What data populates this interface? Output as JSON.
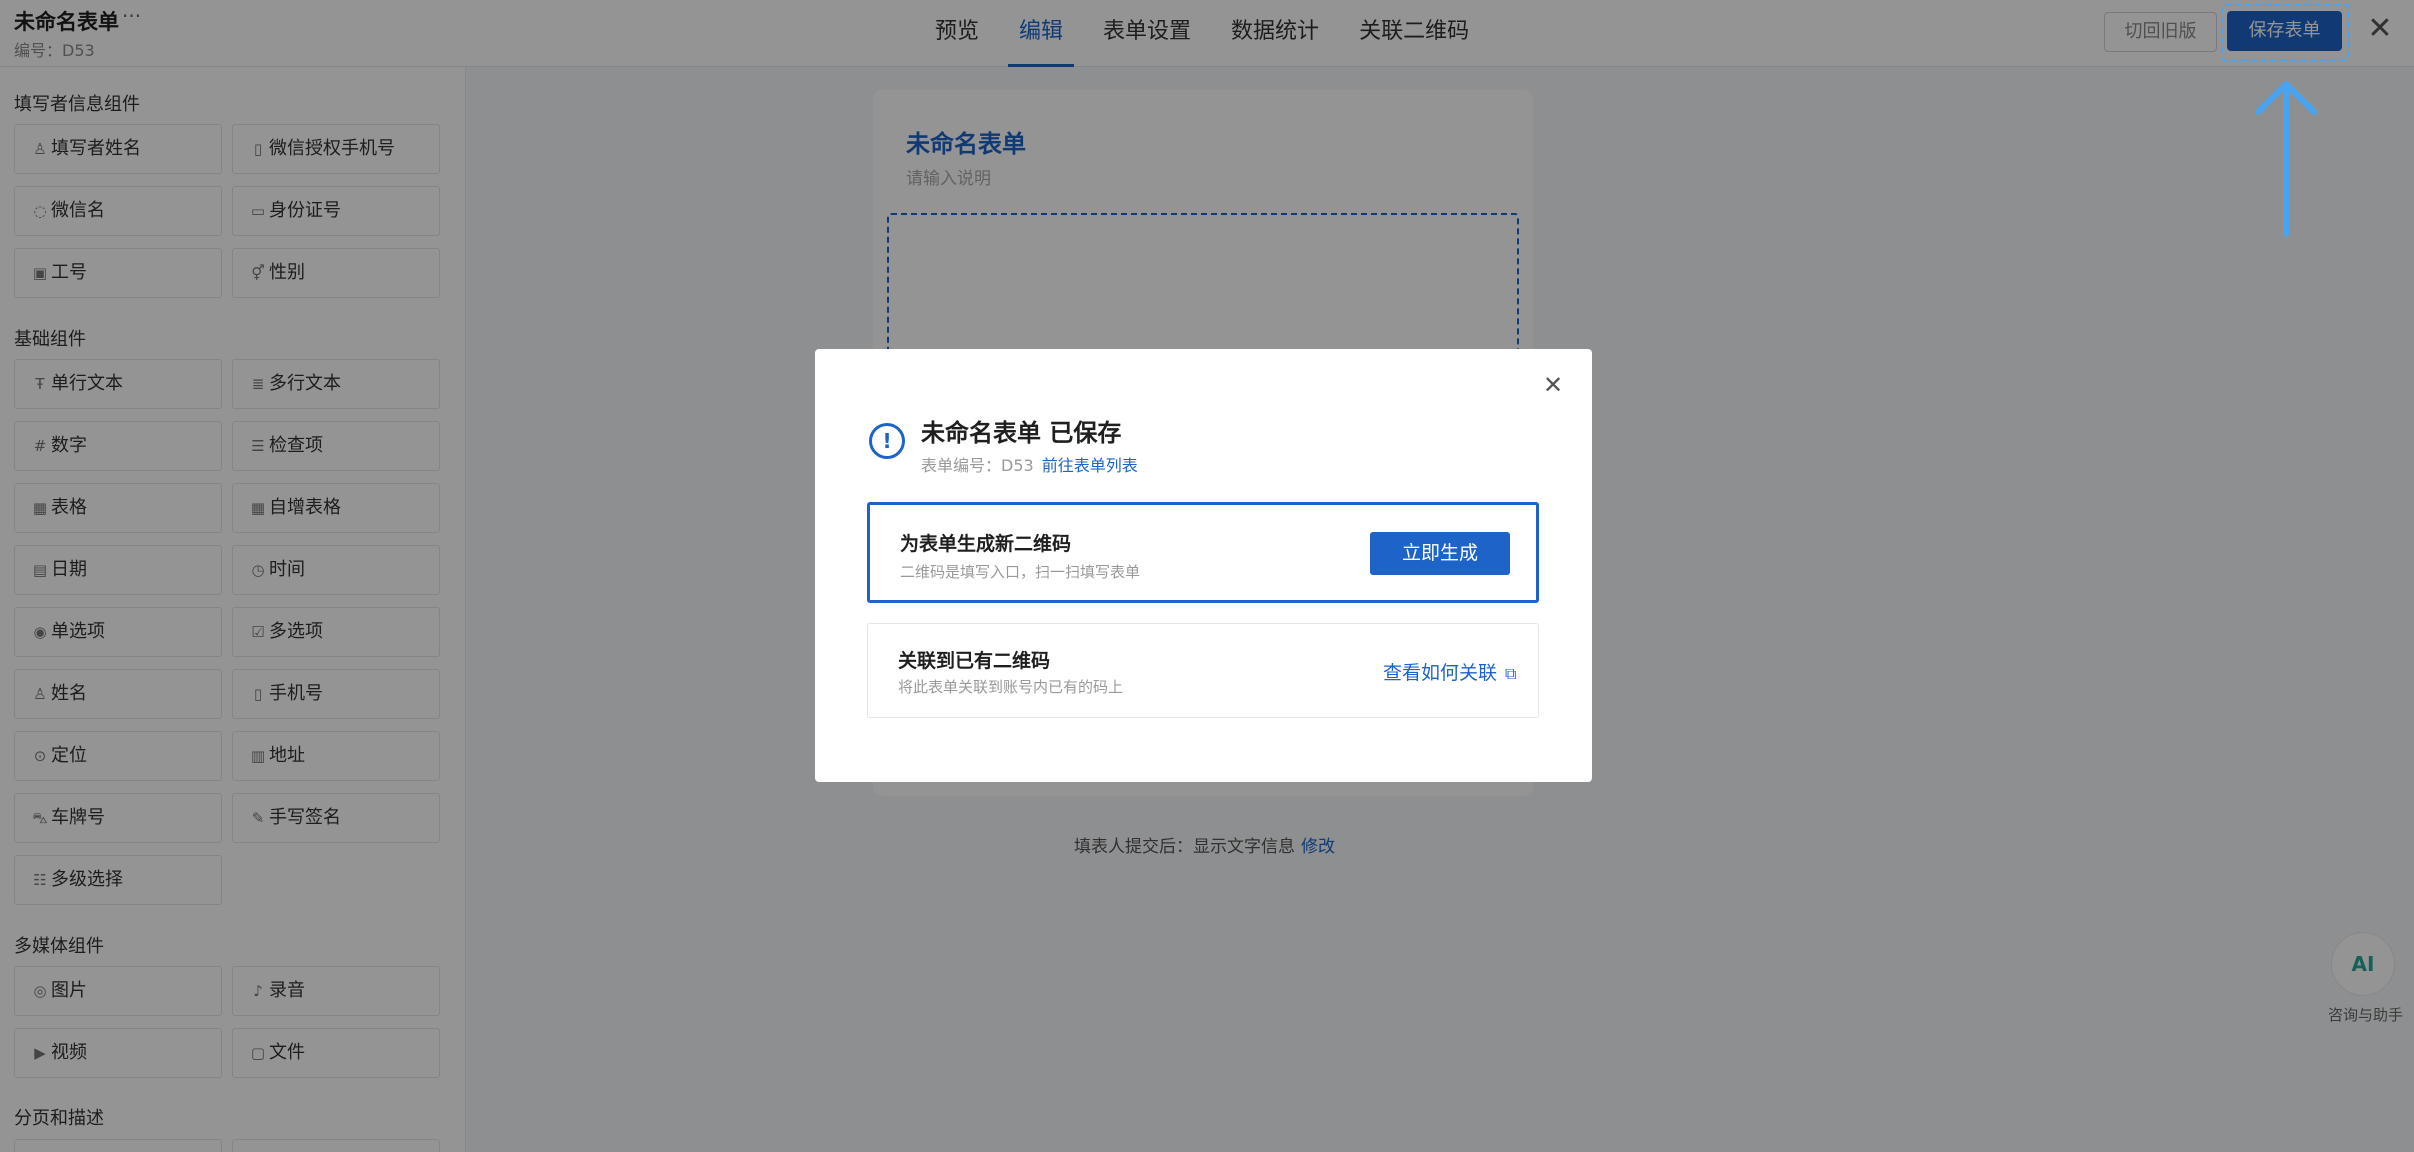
{
  "header": {
    "form_name": "未命名表单",
    "more": "···",
    "form_code": "编号：D53",
    "tabs": [
      "预览",
      "编辑",
      "表单设置",
      "数据统计",
      "关联二维码"
    ],
    "active_tab": "编辑",
    "old_version_label": "切回旧版",
    "save_label": "保存表单",
    "close_glyph": "✕"
  },
  "sidebar": {
    "sections": [
      {
        "title": "填写者信息组件",
        "items": [
          {
            "label": "填写者姓名",
            "icon": "person-icon"
          },
          {
            "label": "微信授权手机号",
            "icon": "phone-icon"
          },
          {
            "label": "微信名",
            "icon": "wechat-icon"
          },
          {
            "label": "身份证号",
            "icon": "id-card-icon"
          },
          {
            "label": "工号",
            "icon": "badge-icon"
          },
          {
            "label": "性别",
            "icon": "gender-icon"
          }
        ]
      },
      {
        "title": "基础组件",
        "items": [
          {
            "label": "单行文本",
            "icon": "text-icon"
          },
          {
            "label": "多行文本",
            "icon": "multiline-icon"
          },
          {
            "label": "数字",
            "icon": "number-icon"
          },
          {
            "label": "检查项",
            "icon": "checklist-icon"
          },
          {
            "label": "表格",
            "icon": "table-icon"
          },
          {
            "label": "自增表格",
            "icon": "table-plus-icon"
          },
          {
            "label": "日期",
            "icon": "calendar-icon"
          },
          {
            "label": "时间",
            "icon": "clock-icon"
          },
          {
            "label": "单选项",
            "icon": "radio-icon"
          },
          {
            "label": "多选项",
            "icon": "checkbox-icon"
          },
          {
            "label": "姓名",
            "icon": "person-icon"
          },
          {
            "label": "手机号",
            "icon": "phone-icon"
          },
          {
            "label": "定位",
            "icon": "location-icon"
          },
          {
            "label": "地址",
            "icon": "address-icon"
          },
          {
            "label": "车牌号",
            "icon": "car-icon"
          },
          {
            "label": "手写签名",
            "icon": "pen-icon"
          },
          {
            "label": "多级选择",
            "icon": "cascade-icon"
          }
        ]
      },
      {
        "title": "多媒体组件",
        "items": [
          {
            "label": "图片",
            "icon": "camera-icon"
          },
          {
            "label": "录音",
            "icon": "mic-icon"
          },
          {
            "label": "视频",
            "icon": "video-icon"
          },
          {
            "label": "文件",
            "icon": "file-icon"
          }
        ]
      },
      {
        "title": "分页和描述",
        "items": []
      }
    ]
  },
  "canvas": {
    "title": "未命名表单",
    "desc_placeholder": "请输入说明",
    "submit_info": "填表人提交后：显示文字信息",
    "submit_edit": "修改"
  },
  "assistant": {
    "label": "咨询与助手",
    "icon_text": "AI"
  },
  "modal": {
    "title": "未命名表单 已保存",
    "code": "表单编号：D53",
    "list_link": "前往表单列表",
    "option1": {
      "title": "为表单生成新二维码",
      "desc": "二维码是填写入口，扫一扫填写表单",
      "button": "立即生成"
    },
    "option2": {
      "title": "关联到已有二维码",
      "desc": "将此表单关联到账号内已有的码上",
      "button": "查看如何关联"
    },
    "close_glyph": "✕"
  },
  "colors": {
    "accent": "#1e64c8",
    "highlight": "#4aa3f0"
  }
}
